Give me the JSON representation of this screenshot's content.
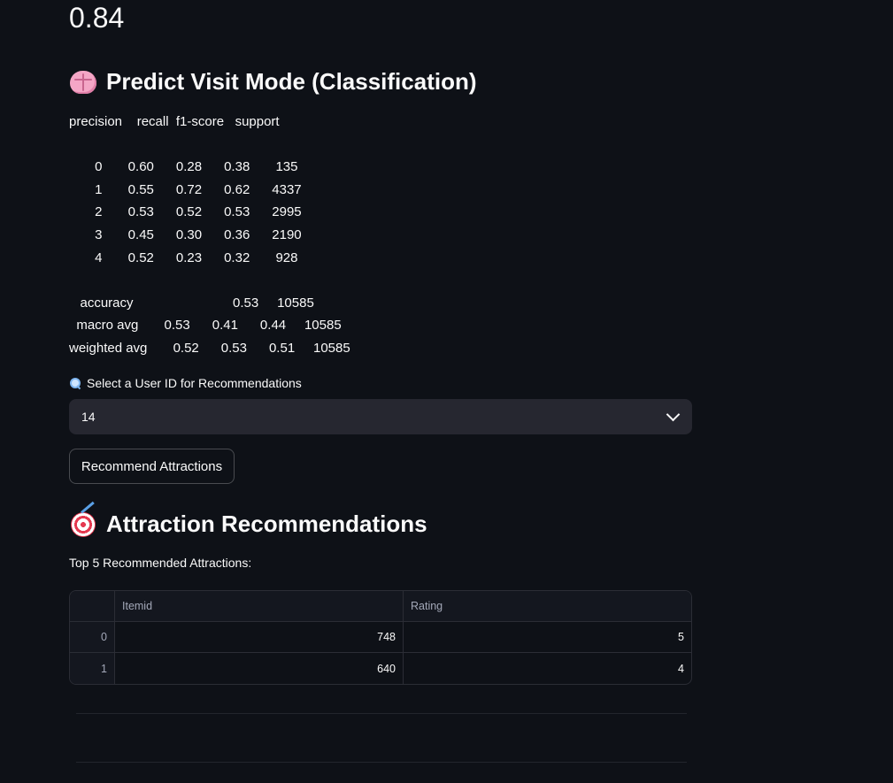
{
  "metric": {
    "value": "0.84"
  },
  "classification": {
    "title": "Predict Visit Mode (Classification)",
    "title_icon": "brain-icon",
    "report": {
      "header": "precision    recall  f1-score   support",
      "rows": [
        "       0       0.60      0.28      0.38       135",
        "       1       0.55      0.72      0.62      4337",
        "       2       0.53      0.52      0.53      2995",
        "       3       0.45      0.30      0.36      2190",
        "       4       0.52      0.23      0.32       928"
      ],
      "summary": [
        "   accuracy                           0.53     10585",
        "  macro avg       0.53      0.41      0.44     10585",
        "weighted avg       0.52      0.53      0.51     10585"
      ]
    }
  },
  "selector": {
    "label": "Select a User ID for Recommendations",
    "label_icon": "magnifier-icon",
    "selected": "14"
  },
  "recommend_button": {
    "label": "Recommend Attractions"
  },
  "recommendations": {
    "title": "Attraction Recommendations",
    "title_icon": "target-icon",
    "caption": "Top 5 Recommended Attractions:",
    "table": {
      "columns": [
        "",
        "Itemid",
        "Rating"
      ],
      "rows": [
        {
          "index": "0",
          "itemid": "748",
          "rating": "5"
        },
        {
          "index": "1",
          "itemid": "640",
          "rating": "4"
        }
      ]
    }
  },
  "colors": {
    "background": "#0e1117",
    "text": "#fafafa",
    "input_bg": "#262730",
    "border": "#2b2d35"
  }
}
